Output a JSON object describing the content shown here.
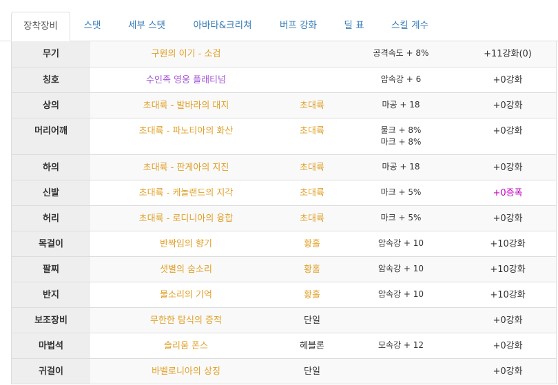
{
  "tabs": [
    {
      "label": "장착장비",
      "active": true
    },
    {
      "label": "스탯",
      "active": false
    },
    {
      "label": "세부 스탯",
      "active": false
    },
    {
      "label": "아바타&크리쳐",
      "active": false
    },
    {
      "label": "버프 강화",
      "active": false
    },
    {
      "label": "딜 표",
      "active": false
    },
    {
      "label": "스킬 계수",
      "active": false
    }
  ],
  "equipment": [
    {
      "slot": "무기",
      "name": "구원의 이기 - 소검",
      "set": "",
      "options": [
        "공격속도 + 8%"
      ],
      "enhance": "+11강화(0)"
    },
    {
      "slot": "칭호",
      "name": "수인족 영웅 플래티넘",
      "set": "",
      "options": [
        "암속강 + 6"
      ],
      "enhance": "+0강화"
    },
    {
      "slot": "상의",
      "name": "초대륙 - 발바라의 대지",
      "set": "초대륙",
      "options": [
        "마공 + 18"
      ],
      "enhance": "+0강화"
    },
    {
      "slot": "머리어깨",
      "name": "초대륙 - 파노티아의 화산",
      "set": "초대륙",
      "options": [
        "물크 + 8%",
        "마크 + 8%"
      ],
      "enhance": "+0강화"
    },
    {
      "slot": "하의",
      "name": "초대륙 - 판게아의 지진",
      "set": "초대륙",
      "options": [
        "마공 + 18"
      ],
      "enhance": "+0강화"
    },
    {
      "slot": "신발",
      "name": "초대륙 - 케놀랜드의 지각",
      "set": "초대륙",
      "options": [
        "마크 + 5%"
      ],
      "enhance": "+0증폭"
    },
    {
      "slot": "허리",
      "name": "초대륙 - 로디니아의 융합",
      "set": "초대륙",
      "options": [
        "마크 + 5%"
      ],
      "enhance": "+0강화"
    },
    {
      "slot": "목걸이",
      "name": "반짝임의 향기",
      "set": "황홀",
      "options": [
        "암속강 + 10"
      ],
      "enhance": "+10강화"
    },
    {
      "slot": "팔찌",
      "name": "샛별의 숨소리",
      "set": "황홀",
      "options": [
        "암속강 + 10"
      ],
      "enhance": "+10강화"
    },
    {
      "slot": "반지",
      "name": "물소리의 기억",
      "set": "황홀",
      "options": [
        "암속강 + 10"
      ],
      "enhance": "+10강화"
    },
    {
      "slot": "보조장비",
      "name": "무한한 탐식의 증적",
      "set": "단일",
      "options": [],
      "enhance": "+0강화"
    },
    {
      "slot": "마법석",
      "name": "솔리움 폰스",
      "set": "헤블론",
      "options": [
        "모속강 + 12"
      ],
      "enhance": "+0강화"
    },
    {
      "slot": "귀걸이",
      "name": "바벨로니아의 상징",
      "set": "단일",
      "options": [],
      "enhance": "+0강화"
    }
  ],
  "colors": {
    "item_name": "#e0a028",
    "title_name": "#a452d6",
    "amplify": "#c400c4",
    "tab_link": "#337ab7"
  }
}
